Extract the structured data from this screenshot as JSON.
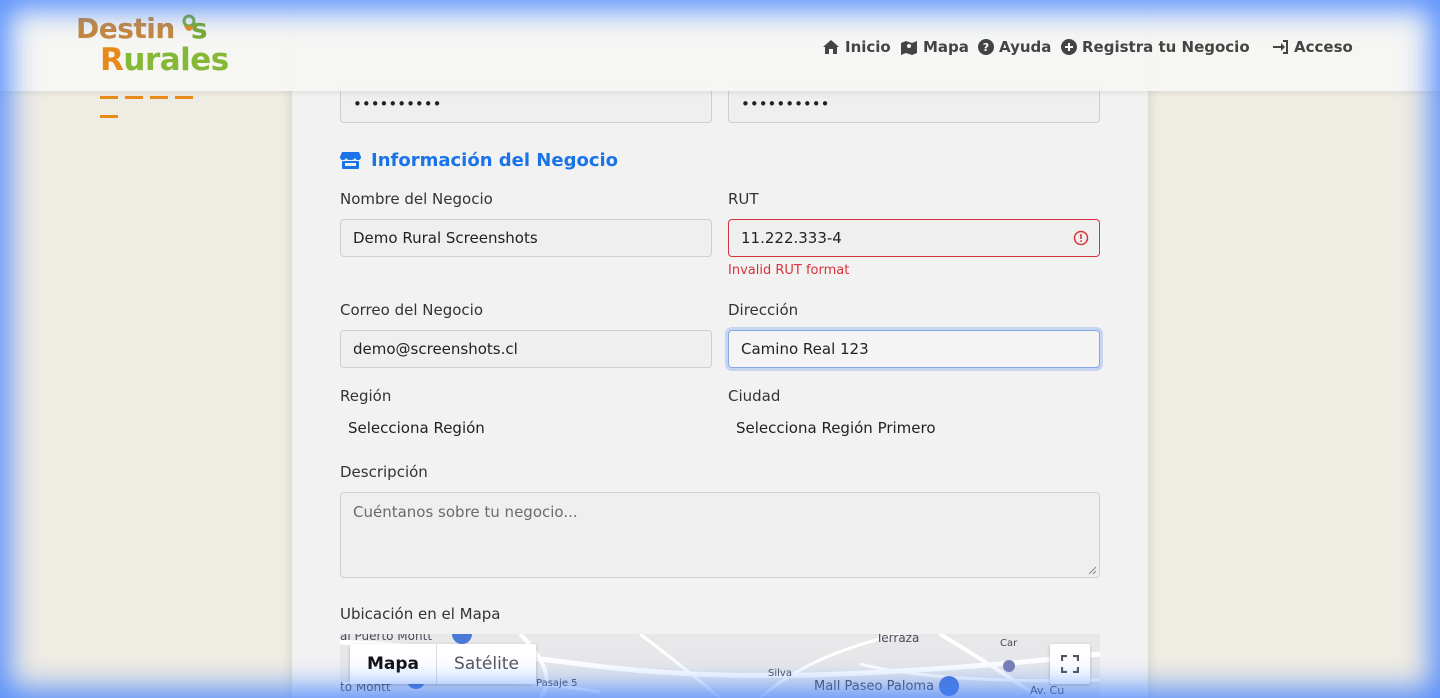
{
  "brand": {
    "line1": "Destin",
    "line1_accent": "s",
    "line2": "urales",
    "line2_initial": "R"
  },
  "nav": {
    "items": [
      {
        "label": "Inicio",
        "icon": "home-icon"
      },
      {
        "label": "Mapa",
        "icon": "map-icon"
      },
      {
        "label": "Ayuda",
        "icon": "question-circle-icon"
      },
      {
        "label": "Registra tu Negocio",
        "icon": "plus-circle-icon"
      },
      {
        "label": "Acceso",
        "icon": "sign-in-icon"
      }
    ]
  },
  "form": {
    "password": "••••••••••",
    "password_confirm": "••••••••••",
    "section_title": "Información del Negocio",
    "business_name": {
      "label": "Nombre del Negocio",
      "value": "Demo Rural Screenshots"
    },
    "rut": {
      "label": "RUT",
      "value": "11.222.333-4",
      "error": "Invalid RUT format"
    },
    "email": {
      "label": "Correo del Negocio",
      "value": "demo@screenshots.cl"
    },
    "address": {
      "label": "Dirección",
      "value": "Camino Real 123"
    },
    "region": {
      "label": "Región",
      "value": "Selecciona Región"
    },
    "city": {
      "label": "Ciudad",
      "value": "Selecciona Región Primero"
    },
    "description": {
      "label": "Descripción",
      "placeholder": "Cuéntanos sobre tu negocio..."
    },
    "map": {
      "label": "Ubicación en el Mapa",
      "tab_map": "Mapa",
      "tab_satellite": "Satélite",
      "places": [
        "al Puerto Montt",
        "to Montt",
        "Mall Paseo Paloma",
        "Terraza",
        "Pasaje 5",
        "Av. Cu",
        "Silva",
        "Car"
      ]
    }
  },
  "colors": {
    "accent": "#1a73e8",
    "error": "#d9343b",
    "glow": "#4080ff"
  }
}
